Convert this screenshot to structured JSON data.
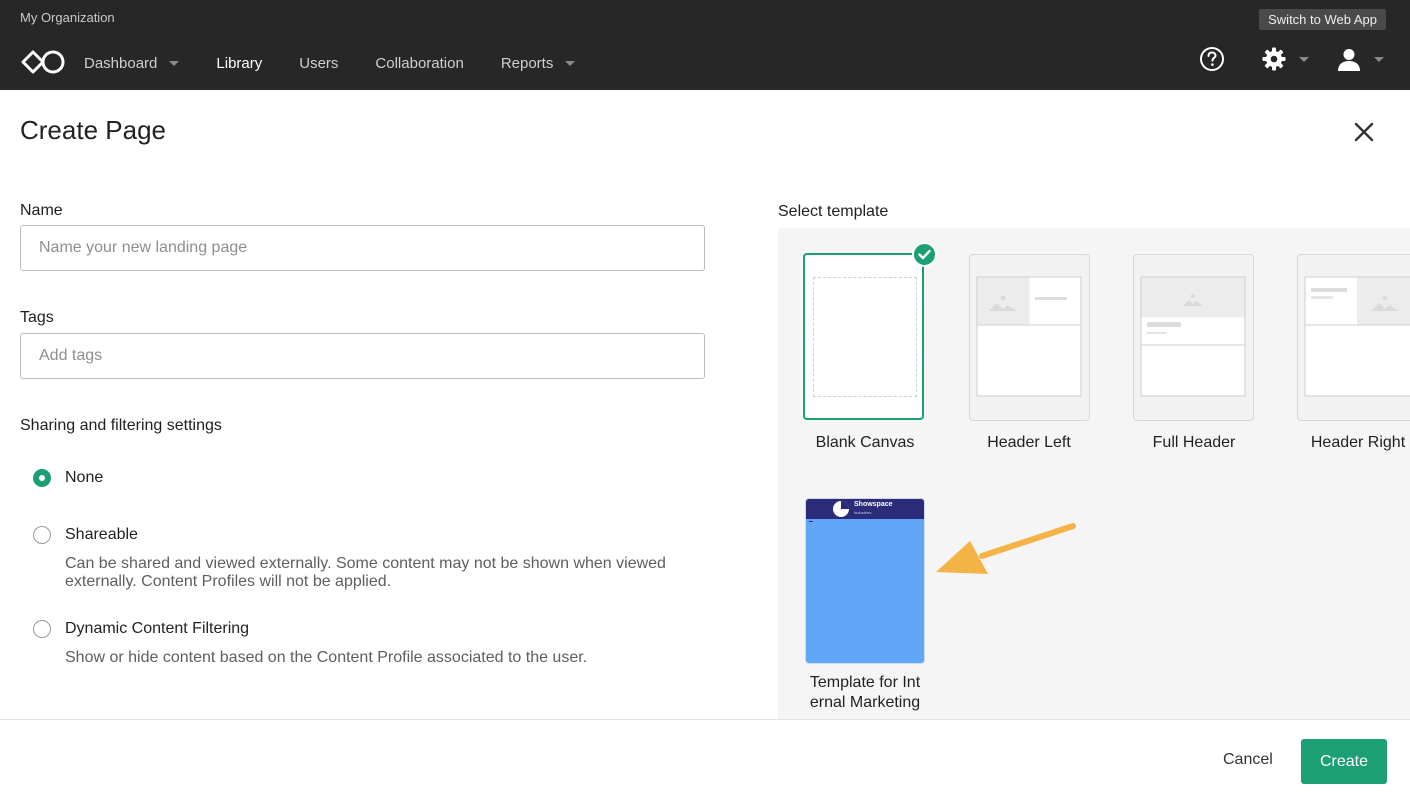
{
  "header": {
    "org_name": "My Organization",
    "switch_label": "Switch to Web App",
    "nav": [
      {
        "label": "Dashboard",
        "has_menu": true
      },
      {
        "label": "Library",
        "active": true
      },
      {
        "label": "Users"
      },
      {
        "label": "Collaboration"
      },
      {
        "label": "Reports",
        "has_menu": true
      }
    ],
    "icons": [
      "help-icon",
      "gear-icon",
      "user-icon"
    ]
  },
  "page": {
    "title": "Create Page"
  },
  "form": {
    "name_label": "Name",
    "name_placeholder": "Name your new landing page",
    "name_value": "",
    "tags_label": "Tags",
    "tags_placeholder": "Add tags",
    "sharing_label": "Sharing and filtering settings",
    "options": [
      {
        "label": "None",
        "checked": true,
        "description": ""
      },
      {
        "label": "Shareable",
        "checked": false,
        "description": "Can be shared and viewed externally. Some content may not be shown when viewed externally. Content Profiles will not be applied."
      },
      {
        "label": "Dynamic Content Filtering",
        "checked": false,
        "description": "Show or hide content based on the Content Profile associated to the user."
      }
    ]
  },
  "templates": {
    "label": "Select template",
    "items": [
      {
        "name": "Blank Canvas",
        "selected": true
      },
      {
        "name": "Header Left"
      },
      {
        "name": "Full Header"
      },
      {
        "name": "Header Right"
      },
      {
        "name": "Template for Int\nernal Marketing",
        "thumb_brand": "Showspace",
        "thumb_sub": "Industries"
      }
    ]
  },
  "footer": {
    "cancel_label": "Cancel",
    "create_label": "Create"
  },
  "colors": {
    "accent": "#1b9f73",
    "topbar": "#272727",
    "template_blue": "#62a6f7",
    "template_band": "#2a2b79",
    "arrow": "#f4b346"
  }
}
